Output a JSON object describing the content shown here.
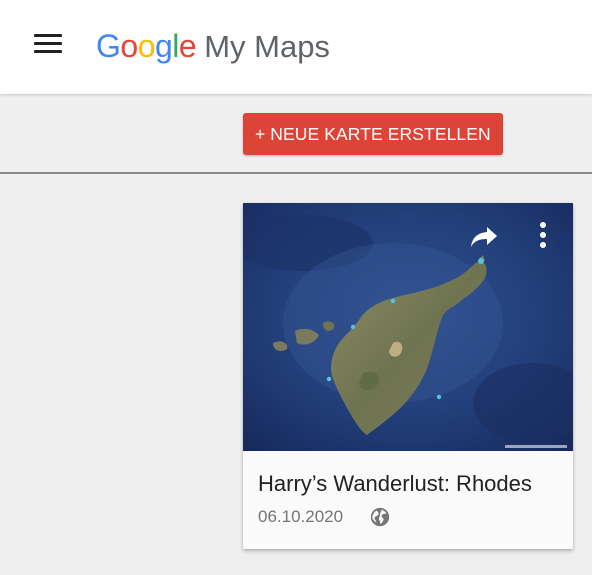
{
  "header": {
    "logo_letters": [
      {
        "char": "G",
        "color": "#4285F4"
      },
      {
        "char": "o",
        "color": "#EA4335"
      },
      {
        "char": "o",
        "color": "#FBBC05"
      },
      {
        "char": "g",
        "color": "#4285F4"
      },
      {
        "char": "l",
        "color": "#34A853"
      },
      {
        "char": "e",
        "color": "#EA4335"
      }
    ],
    "product_name": "My Maps",
    "menu_icon": "hamburger-menu-icon"
  },
  "toolbar": {
    "create_label": "+ NEUE KARTE ERSTELLEN",
    "create_color": "#db4437"
  },
  "maps": [
    {
      "title": "Harry’s Wanderlust: Rhodes",
      "date": "06.10.2020",
      "visibility_icon": "globe-icon",
      "actions": [
        "share-icon",
        "more-vert-icon"
      ]
    }
  ]
}
